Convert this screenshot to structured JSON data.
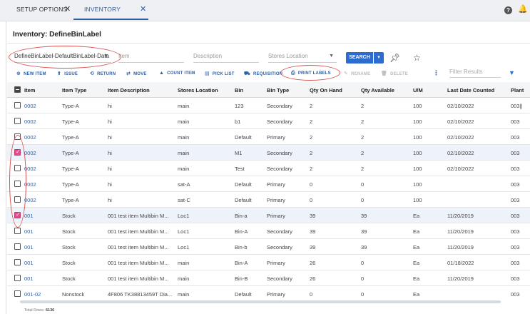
{
  "tabs": [
    {
      "label": "SETUP OPTIONS"
    },
    {
      "label": "INVENTORY"
    }
  ],
  "top_icons": {
    "help": "?",
    "alert": "bell-icon"
  },
  "page_title": "Inventory: DefineBinLabel",
  "filters": {
    "view": "DefineBinLabel-DefaultBinLabel-Data",
    "item_placeholder": "Item",
    "description_placeholder": "Description",
    "stores_location_placeholder": "Stores Location",
    "search_label": "SEARCH"
  },
  "toolbar": {
    "new_item": "NEW ITEM",
    "issue": "ISSUE",
    "return": "RETURN",
    "move": "MOVE",
    "count_item": "COUNT ITEM",
    "pick_list": "PICK LIST",
    "requisition": "REQUISITION",
    "print_labels": "PRINT LABELS",
    "rename": "RENAME",
    "delete": "DELETE",
    "filter_placeholder": "Filter Results"
  },
  "columns": [
    "Item",
    "Item Type",
    "Item Description",
    "Stores Location",
    "Bin",
    "Bin Type",
    "Qty On Hand",
    "Qty Available",
    "U/M",
    "Last Date Counted",
    "Plant"
  ],
  "rows": [
    {
      "item": "0002",
      "type": "Type-A",
      "desc": "hi",
      "loc": "main",
      "bin": "123",
      "bin_type": "Secondary",
      "qoh": "2",
      "qa": "2",
      "um": "100",
      "ldc": "02/10/2022",
      "plant": "003||",
      "checked": false
    },
    {
      "item": "0002",
      "type": "Type-A",
      "desc": "hi",
      "loc": "main",
      "bin": "b1",
      "bin_type": "Secondary",
      "qoh": "2",
      "qa": "2",
      "um": "100",
      "ldc": "02/10/2022",
      "plant": "003",
      "checked": false
    },
    {
      "item": "0002",
      "type": "Type-A",
      "desc": "hi",
      "loc": "main",
      "bin": "Default",
      "bin_type": "Primary",
      "qoh": "2",
      "qa": "2",
      "um": "100",
      "ldc": "02/10/2022",
      "plant": "003",
      "checked": false
    },
    {
      "item": "0002",
      "type": "Type-A",
      "desc": "hi",
      "loc": "main",
      "bin": "M1",
      "bin_type": "Secondary",
      "qoh": "2",
      "qa": "2",
      "um": "100",
      "ldc": "02/10/2022",
      "plant": "003",
      "checked": true
    },
    {
      "item": "0002",
      "type": "Type-A",
      "desc": "hi",
      "loc": "main",
      "bin": "Test",
      "bin_type": "Secondary",
      "qoh": "2",
      "qa": "2",
      "um": "100",
      "ldc": "02/10/2022",
      "plant": "003",
      "checked": false
    },
    {
      "item": "0002",
      "type": "Type-A",
      "desc": "hi",
      "loc": "sat-A",
      "bin": "Default",
      "bin_type": "Primary",
      "qoh": "0",
      "qa": "0",
      "um": "100",
      "ldc": "",
      "plant": "003",
      "checked": false
    },
    {
      "item": "0002",
      "type": "Type-A",
      "desc": "hi",
      "loc": "sat-C",
      "bin": "Default",
      "bin_type": "Primary",
      "qoh": "0",
      "qa": "0",
      "um": "100",
      "ldc": "",
      "plant": "003",
      "checked": false
    },
    {
      "item": "001",
      "type": "Stock",
      "desc": "001 test item Multibin M...",
      "loc": "Loc1",
      "bin": "Bin-a",
      "bin_type": "Primary",
      "qoh": "39",
      "qa": "39",
      "um": "Ea",
      "ldc": "11/20/2019",
      "plant": "003",
      "checked": true
    },
    {
      "item": "001",
      "type": "Stock",
      "desc": "001 test item Multibin M...",
      "loc": "Loc1",
      "bin": "Bin-A",
      "bin_type": "Secondary",
      "qoh": "39",
      "qa": "39",
      "um": "Ea",
      "ldc": "11/20/2019",
      "plant": "003",
      "checked": false
    },
    {
      "item": "001",
      "type": "Stock",
      "desc": "001 test item Multibin M...",
      "loc": "Loc1",
      "bin": "Bin-b",
      "bin_type": "Secondary",
      "qoh": "39",
      "qa": "39",
      "um": "Ea",
      "ldc": "11/20/2019",
      "plant": "003",
      "checked": false
    },
    {
      "item": "001",
      "type": "Stock",
      "desc": "001 test item Multibin M...",
      "loc": "main",
      "bin": "Bin-A",
      "bin_type": "Primary",
      "qoh": "26",
      "qa": "0",
      "um": "Ea",
      "ldc": "01/18/2022",
      "plant": "003",
      "checked": false
    },
    {
      "item": "001",
      "type": "Stock",
      "desc": "001 test item Multibin M...",
      "loc": "main",
      "bin": "Bin-B",
      "bin_type": "Secondary",
      "qoh": "26",
      "qa": "0",
      "um": "Ea",
      "ldc": "11/20/2019",
      "plant": "003",
      "checked": false
    },
    {
      "item": "001-02",
      "type": "Nonstock",
      "desc": "4F806 TK38813459T Dia...",
      "loc": "main",
      "bin": "Default",
      "bin_type": "Primary",
      "qoh": "0",
      "qa": "0",
      "um": "Ea",
      "ldc": "",
      "plant": "003",
      "checked": false
    }
  ],
  "footer": {
    "label": "Total Rows:",
    "value": "6136"
  }
}
